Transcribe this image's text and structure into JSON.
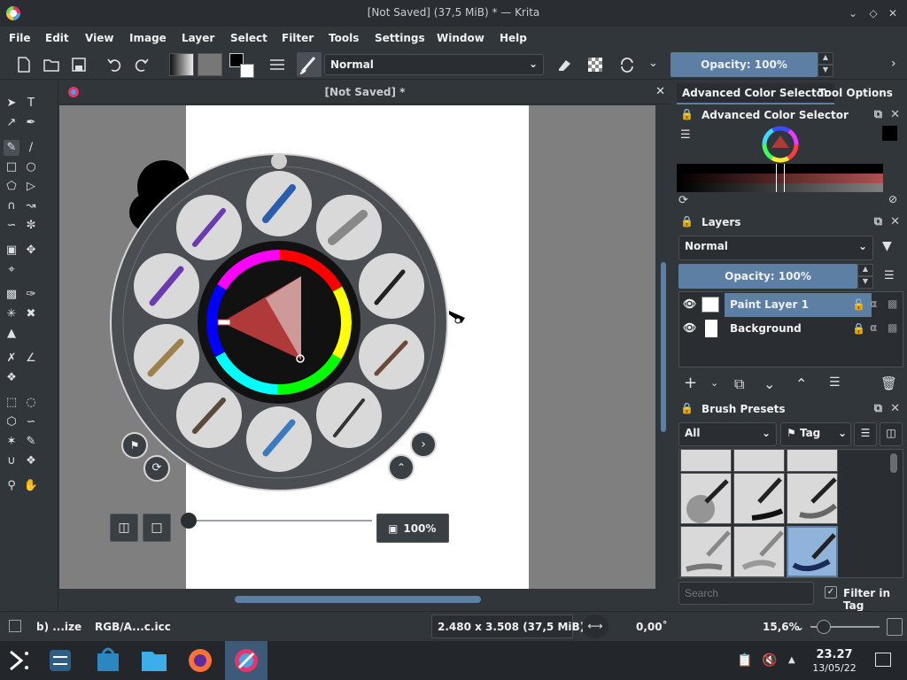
{
  "window": {
    "title": "[Not Saved] (37,5 MiB) * — Krita"
  },
  "menu": [
    "File",
    "Edit",
    "View",
    "Image",
    "Layer",
    "Select",
    "Filter",
    "Tools",
    "Settings",
    "Window",
    "Help"
  ],
  "toolbar": {
    "blend_mode": "Normal",
    "opacity": "Opacity: 100%"
  },
  "document": {
    "title": "[Not Saved]  *"
  },
  "canvas_overlay": {
    "zoom": "100%"
  },
  "dock_tabs": [
    "Advanced Color Selector",
    "Tool Options"
  ],
  "color_selector": {
    "title": "Advanced Color Selector"
  },
  "layers": {
    "title": "Layers",
    "blend_mode": "Normal",
    "opacity": "Opacity:  100%",
    "items": [
      {
        "name": "Paint Layer 1",
        "selected": true
      },
      {
        "name": "Background",
        "selected": false
      }
    ]
  },
  "brush_presets": {
    "title": "Brush Presets",
    "filter": "All",
    "tag": "Tag",
    "search_placeholder": "Search",
    "filter_in_tag": "Filter in Tag"
  },
  "status": {
    "brush": "b) ...ize",
    "color_profile": "RGB/A...c.icc",
    "size": "2.480 x 3.508 (37,5 MiB)",
    "rotation": "0,00˚",
    "zoom": "15,6%"
  },
  "taskbar": {
    "time": "23.27",
    "date": "13/05/22"
  },
  "colors": {
    "accent": "#5c7fa3",
    "bg": "#31363b"
  }
}
